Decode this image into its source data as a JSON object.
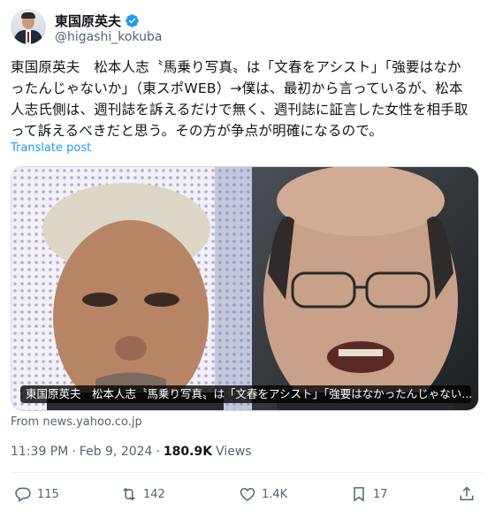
{
  "author": {
    "display_name": "東国原英夫",
    "handle": "@higashi_kokuba",
    "verified_color": "#1d9bf0"
  },
  "tweet": {
    "lines": [
      "東国原英夫　松本人志〝馬乗り写真〟は「文春をアシスト」「強要はなか",
      "ったんじゃないか」（東スポWEB）→僕は、最初から言っているが、松本",
      "人志氏側は、週刊誌を訴えるだけで無く、週刊誌に証言した女性を相手取",
      "って訴えるべきだと思う。その方が争点が明確になるので。"
    ],
    "translate_label": "Translate post"
  },
  "card": {
    "caption": "東国原英夫　松本人志〝馬乗り写真〟は「文春をアシスト」「強要はなかったんじゃない...",
    "source": "From news.yahoo.co.jp"
  },
  "meta": {
    "time": "11:39 PM",
    "separator": "·",
    "date": "Feb 9, 2024",
    "views_count": "180.9K",
    "views_label": "Views"
  },
  "actions": {
    "reply": {
      "icon": "reply-icon",
      "count": "115"
    },
    "repost": {
      "icon": "repost-icon",
      "count": "142"
    },
    "like": {
      "icon": "heart-icon",
      "count": "1.4K"
    },
    "bookmark": {
      "icon": "bookmark-icon",
      "count": "17"
    },
    "share": {
      "icon": "share-icon"
    }
  },
  "colors": {
    "text": "#0f1419",
    "secondary": "#536471",
    "accent": "#1d9bf0"
  }
}
